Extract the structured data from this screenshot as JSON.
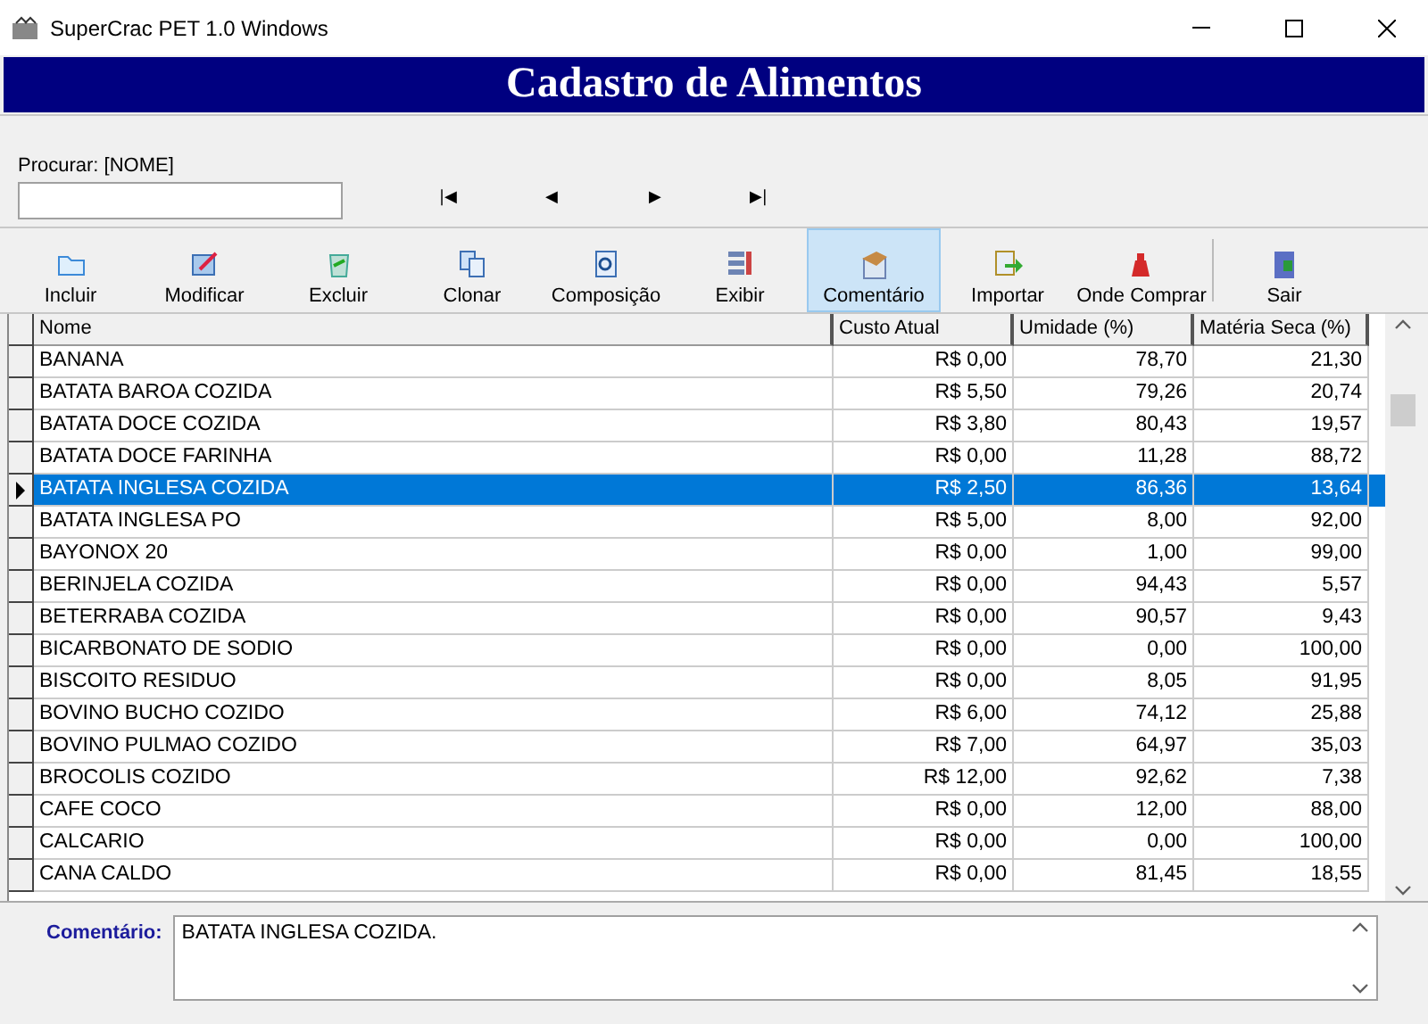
{
  "window": {
    "title": "SuperCrac PET 1.0 Windows"
  },
  "header": {
    "title": "Cadastro de Alimentos"
  },
  "search": {
    "label": "Procurar: [NOME]"
  },
  "navigation": [
    "|◀",
    "◀",
    "▶",
    "▶|"
  ],
  "toolbar": [
    {
      "label": "Incluir",
      "selected": false
    },
    {
      "label": "Modificar",
      "selected": false
    },
    {
      "label": "Excluir",
      "selected": false
    },
    {
      "label": "Clonar",
      "selected": false
    },
    {
      "label": "Composição",
      "selected": false
    },
    {
      "label": "Exibir",
      "selected": false
    },
    {
      "label": "Comentário",
      "selected": true
    },
    {
      "label": "Importar",
      "selected": false
    },
    {
      "label": "Onde Comprar",
      "selected": false
    },
    {
      "label": "Sair",
      "selected": false
    }
  ],
  "table": {
    "columns": [
      "Nome",
      "Custo Atual",
      "Umidade (%)",
      "Matéria Seca (%)"
    ],
    "rows": [
      {
        "cells": [
          "BANANA",
          "R$ 0,00",
          "78,70",
          "21,30"
        ],
        "selected": false
      },
      {
        "cells": [
          "BATATA BAROA COZIDA",
          "R$ 5,50",
          "79,26",
          "20,74"
        ],
        "selected": false
      },
      {
        "cells": [
          "BATATA DOCE COZIDA",
          "R$ 3,80",
          "80,43",
          "19,57"
        ],
        "selected": false
      },
      {
        "cells": [
          "BATATA DOCE FARINHA",
          "R$ 0,00",
          "11,28",
          "88,72"
        ],
        "selected": false
      },
      {
        "cells": [
          "BATATA INGLESA COZIDA",
          "R$ 2,50",
          "86,36",
          "13,64"
        ],
        "selected": true
      },
      {
        "cells": [
          "BATATA INGLESA PO",
          "R$ 5,00",
          "8,00",
          "92,00"
        ],
        "selected": false
      },
      {
        "cells": [
          "BAYONOX 20",
          "R$ 0,00",
          "1,00",
          "99,00"
        ],
        "selected": false
      },
      {
        "cells": [
          "BERINJELA COZIDA",
          "R$ 0,00",
          "94,43",
          "5,57"
        ],
        "selected": false
      },
      {
        "cells": [
          "BETERRABA COZIDA",
          "R$ 0,00",
          "90,57",
          "9,43"
        ],
        "selected": false
      },
      {
        "cells": [
          "BICARBONATO DE SODIO",
          "R$ 0,00",
          "0,00",
          "100,00"
        ],
        "selected": false
      },
      {
        "cells": [
          "BISCOITO RESIDUO",
          "R$ 0,00",
          "8,05",
          "91,95"
        ],
        "selected": false
      },
      {
        "cells": [
          "BOVINO BUCHO COZIDO",
          "R$ 6,00",
          "74,12",
          "25,88"
        ],
        "selected": false
      },
      {
        "cells": [
          "BOVINO PULMAO COZIDO",
          "R$ 7,00",
          "64,97",
          "35,03"
        ],
        "selected": false
      },
      {
        "cells": [
          "BROCOLIS COZIDO",
          "R$ 12,00",
          "92,62",
          "7,38"
        ],
        "selected": false
      },
      {
        "cells": [
          "CAFE COCO",
          "R$ 0,00",
          "12,00",
          "88,00"
        ],
        "selected": false
      },
      {
        "cells": [
          "CALCARIO",
          "R$ 0,00",
          "0,00",
          "100,00"
        ],
        "selected": false
      },
      {
        "cells": [
          "CANA CALDO",
          "R$ 0,00",
          "81,45",
          "18,55"
        ],
        "selected": false
      }
    ]
  },
  "comment": {
    "label": "Comentário:",
    "value": "BATATA INGLESA COZIDA."
  }
}
